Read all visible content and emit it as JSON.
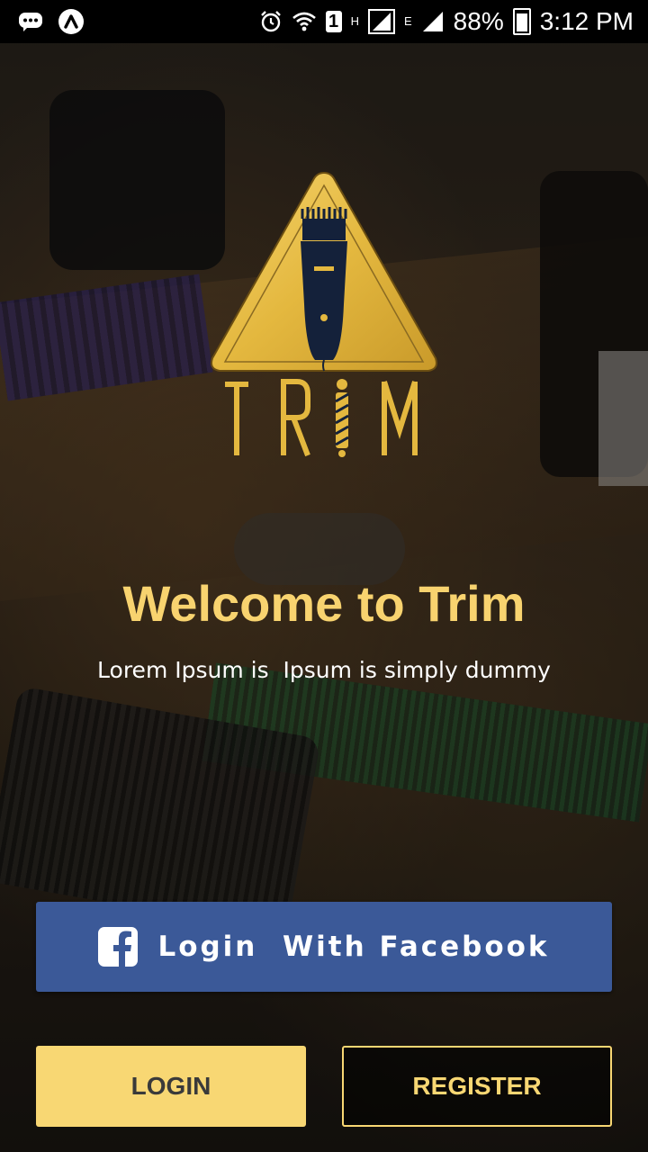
{
  "status_bar": {
    "network_label": "1",
    "signal1_label": "H",
    "signal2_label": "E",
    "battery": "88%",
    "time": "3:12 PM"
  },
  "brand": {
    "logo_text": "TRIM",
    "accent_color": "#f8d36f",
    "facebook_color": "#3b5998"
  },
  "welcome": {
    "title": "Welcome to Trim",
    "subtitle": "Lorem Ipsum is  Ipsum is simply dummy"
  },
  "buttons": {
    "facebook": "Login  With Facebook",
    "login": "LOGIN",
    "register": "REGISTER"
  },
  "icons": [
    "chat-icon",
    "app-icon",
    "alarm-icon",
    "wifi-icon",
    "signal-icon",
    "battery-icon",
    "facebook-icon",
    "clipper-icon"
  ]
}
